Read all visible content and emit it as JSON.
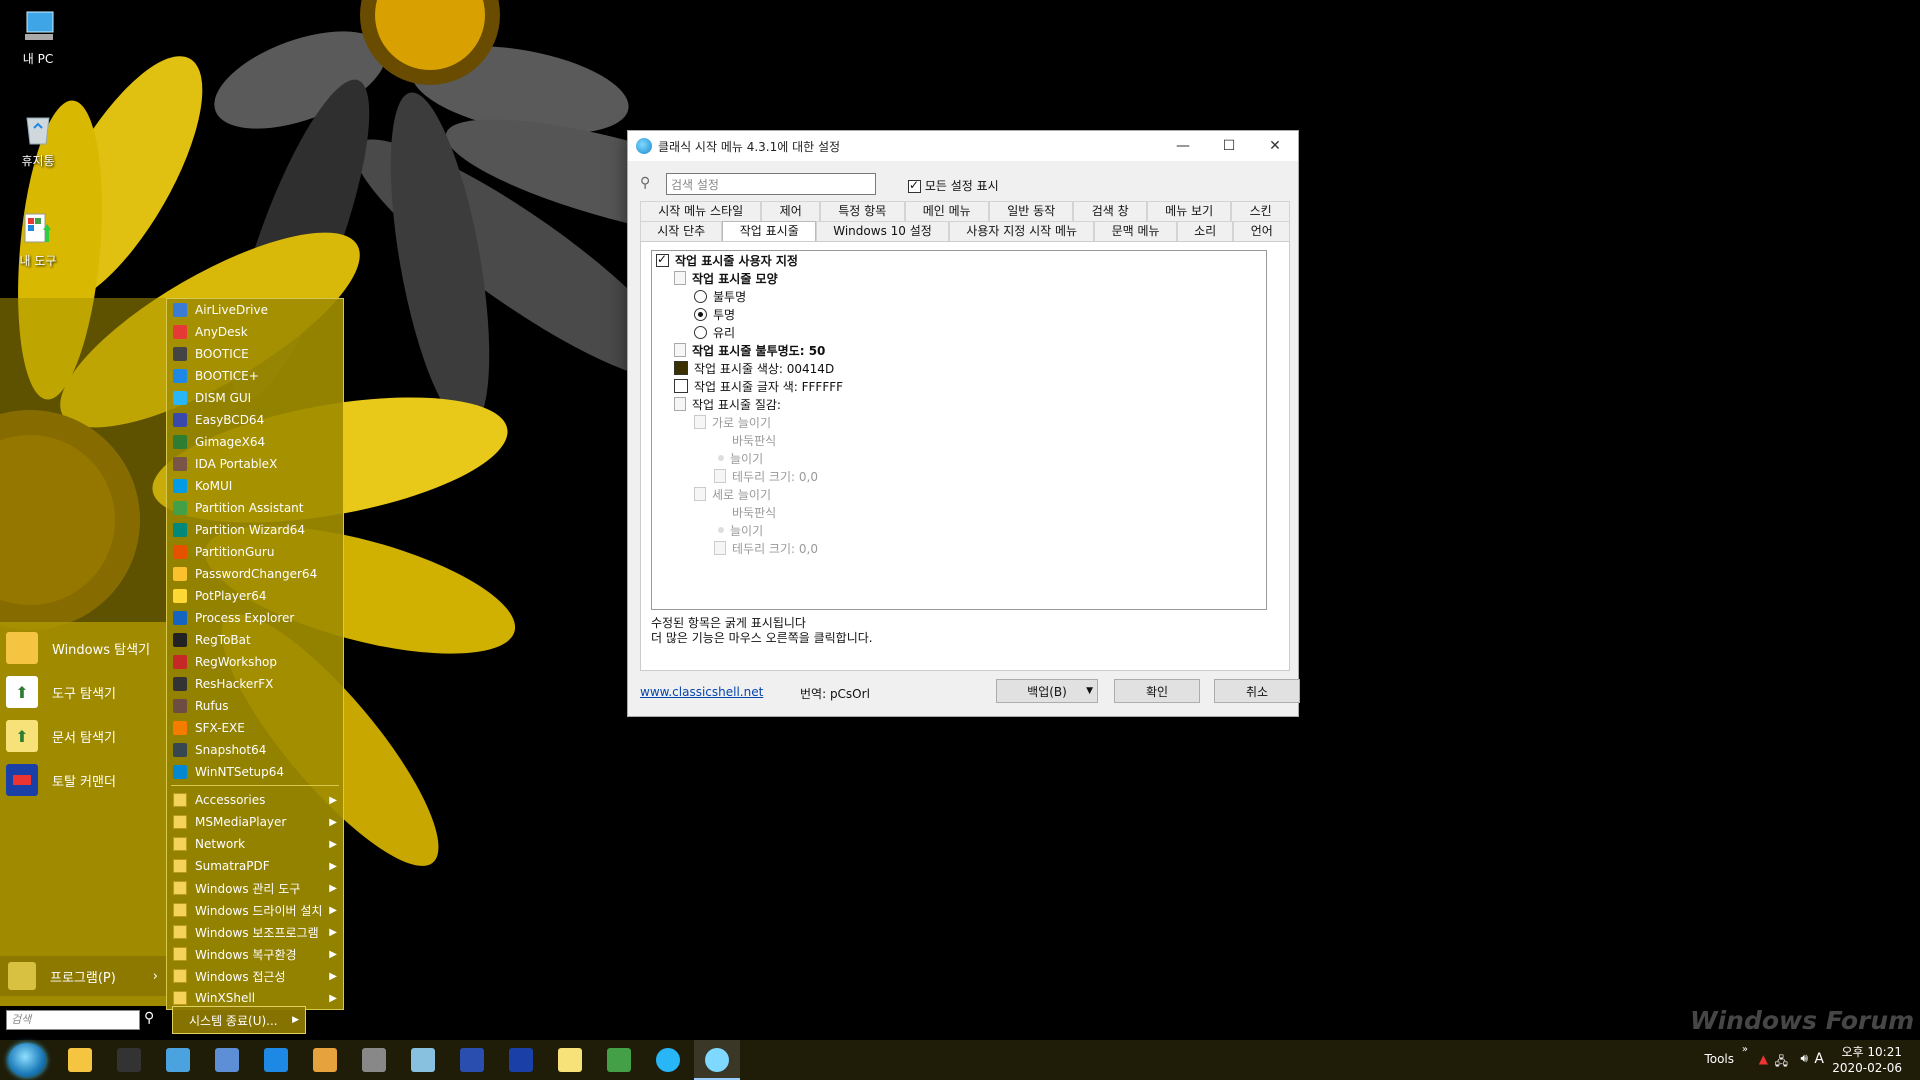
{
  "desktop": {
    "icons": [
      {
        "label": "내 PC",
        "icon": "computer-icon"
      },
      {
        "label": "휴지통",
        "icon": "recycle-bin-icon"
      },
      {
        "label": "내 도구",
        "icon": "tools-icon"
      }
    ],
    "watermark": "Windows Forum"
  },
  "start_menu": {
    "shortcuts": [
      {
        "label": "Windows 탐색기",
        "icon": "folder-icon"
      },
      {
        "label": "도구 탐색기",
        "icon": "tool-explorer-icon"
      },
      {
        "label": "문서 탐색기",
        "icon": "document-explorer-icon"
      },
      {
        "label": "토탈 커맨더",
        "icon": "floppy-icon"
      }
    ],
    "programs_label": "프로그램(P)",
    "search_placeholder": "검색",
    "shutdown_label": "시스템 종료(U)...",
    "apps": [
      {
        "label": "AirLiveDrive",
        "color": "#3a7bd5"
      },
      {
        "label": "AnyDesk",
        "color": "#e53935"
      },
      {
        "label": "BOOTICE",
        "color": "#444444"
      },
      {
        "label": "BOOTICE+",
        "color": "#1e88e5"
      },
      {
        "label": "DISM GUI",
        "color": "#29b6f6"
      },
      {
        "label": "EasyBCD64",
        "color": "#3949ab"
      },
      {
        "label": "GimageX64",
        "color": "#2e7d32"
      },
      {
        "label": "IDA PortableX",
        "color": "#795548"
      },
      {
        "label": "KoMUI",
        "color": "#039be5"
      },
      {
        "label": "Partition Assistant",
        "color": "#43a047"
      },
      {
        "label": "Partition Wizard64",
        "color": "#00897b"
      },
      {
        "label": "PartitionGuru",
        "color": "#e65100"
      },
      {
        "label": "PasswordChanger64",
        "color": "#fbc02d"
      },
      {
        "label": "PotPlayer64",
        "color": "#fdd835"
      },
      {
        "label": "Process Explorer",
        "color": "#1565c0"
      },
      {
        "label": "RegToBat",
        "color": "#222222"
      },
      {
        "label": "RegWorkshop",
        "color": "#c62828"
      },
      {
        "label": "ResHackerFX",
        "color": "#333333"
      },
      {
        "label": "Rufus",
        "color": "#6d4c41"
      },
      {
        "label": "SFX-EXE",
        "color": "#f57c00"
      },
      {
        "label": "Snapshot64",
        "color": "#37474f"
      },
      {
        "label": "WinNTSetup64",
        "color": "#0288d1"
      }
    ],
    "folders": [
      {
        "label": "Accessories"
      },
      {
        "label": "MSMediaPlayer"
      },
      {
        "label": "Network"
      },
      {
        "label": "SumatraPDF"
      },
      {
        "label": "Windows 관리 도구"
      },
      {
        "label": "Windows 드라이버 설치"
      },
      {
        "label": "Windows 보조프로그램"
      },
      {
        "label": "Windows 복구환경"
      },
      {
        "label": "Windows 접근성"
      },
      {
        "label": "WinXShell"
      }
    ]
  },
  "dialog": {
    "title": "클래식 시작 메뉴 4.3.1에 대한 설정",
    "search_placeholder": "검색 설정",
    "show_all_label": "모든 설정 표시",
    "tabs_row1": [
      "시작 메뉴 스타일",
      "제어",
      "특정 항목",
      "메인 메뉴",
      "일반 동작",
      "검색 창",
      "메뉴 보기",
      "스킨"
    ],
    "tabs_row2": [
      "시작 단추",
      "작업 표시줄",
      "Windows 10 설정",
      "사용자 지정 시작 메뉴",
      "문맥 메뉴",
      "소리",
      "언어"
    ],
    "active_tab": "작업 표시줄",
    "tree": {
      "customize": "작업 표시줄 사용자 지정",
      "look": "작업 표시줄 모양",
      "opaque": "불투명",
      "transparent": "투명",
      "glass": "유리",
      "opacity": "작업 표시줄 불투명도: 50",
      "color": "작업 표시줄 색상: 00414D",
      "text_color": "작업 표시줄 글자 색: FFFFFF",
      "texture": "작업 표시줄 질감:",
      "h_stretch": "가로 늘이기",
      "tile1": "바둑판식",
      "stretch1": "늘이기",
      "border1": "테두리 크기: 0,0",
      "v_stretch": "세로 늘이기",
      "tile2": "바둑판식",
      "stretch2": "늘이기",
      "border2": "테두리 크기: 0,0",
      "swatch_color": "#3c3000",
      "swatch_text": "#ffffff"
    },
    "note1": "수정된 항목은 굵게 표시됩니다",
    "note2": "더 많은 기능은 마우스 오른쪽을 클릭합니다.",
    "link": "www.classicshell.net",
    "translator": "번역: pCsOrl",
    "backup_label": "백업(B)",
    "ok_label": "확인",
    "cancel_label": "취소"
  },
  "taskbar": {
    "tools_label": "Tools",
    "lang_indicator": "A",
    "time": "오후 10:21",
    "date": "2020-02-06",
    "pinned": [
      "explorer-icon",
      "cmd-icon",
      "disk-icon",
      "network-icon",
      "ie-icon",
      "media-icon",
      "drive-icon",
      "notepad-icon",
      "grid-icon",
      "floppy-icon",
      "doc-icon",
      "tool-icon",
      "globe-icon",
      "classic-shell-icon"
    ]
  }
}
